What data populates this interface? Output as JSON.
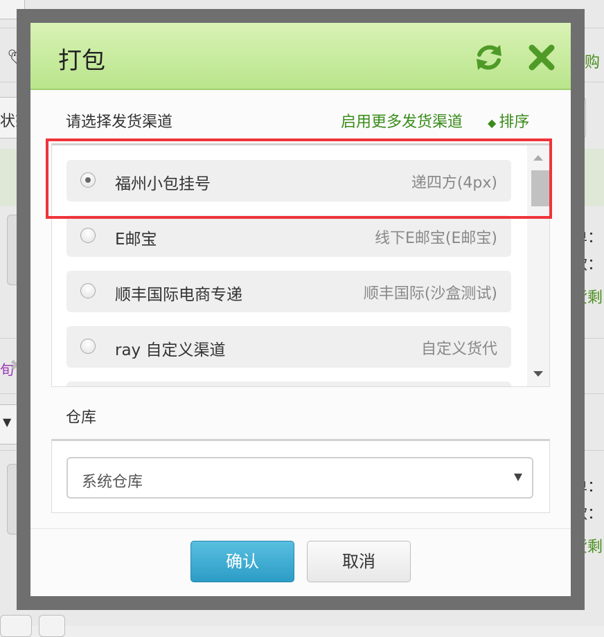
{
  "background": {
    "left_partial": [
      "状态"
    ],
    "right_partial": [
      "已购",
      "单：",
      "款：",
      "货剩",
      "单：",
      "款：",
      "货剩"
    ],
    "tag_text": "旬"
  },
  "modal": {
    "title": "打包",
    "refresh_icon": "refresh-icon",
    "close_icon": "close-icon",
    "channel_section_label": "请选择发货渠道",
    "enable_more_link": "启用更多发货渠道",
    "sort_link": "排序",
    "channels": [
      {
        "name": "福州小包挂号",
        "carrier": "递四方(4px)",
        "selected": true
      },
      {
        "name": "E邮宝",
        "carrier": "线下E邮宝(E邮宝)",
        "selected": false
      },
      {
        "name": "顺丰国际电商专递",
        "carrier": "顺丰国际(沙盒测试)",
        "selected": false
      },
      {
        "name": "ray 自定义渠道",
        "carrier": "自定义货代",
        "selected": false
      }
    ],
    "warehouse_label": "仓库",
    "warehouse_value": "系统仓库",
    "confirm_label": "确认",
    "cancel_label": "取消"
  },
  "colors": {
    "header_green": "#b9e58c",
    "link_green": "#3a8c1b",
    "confirm_blue": "#2c9cc6",
    "highlight_red": "#f0333a"
  }
}
